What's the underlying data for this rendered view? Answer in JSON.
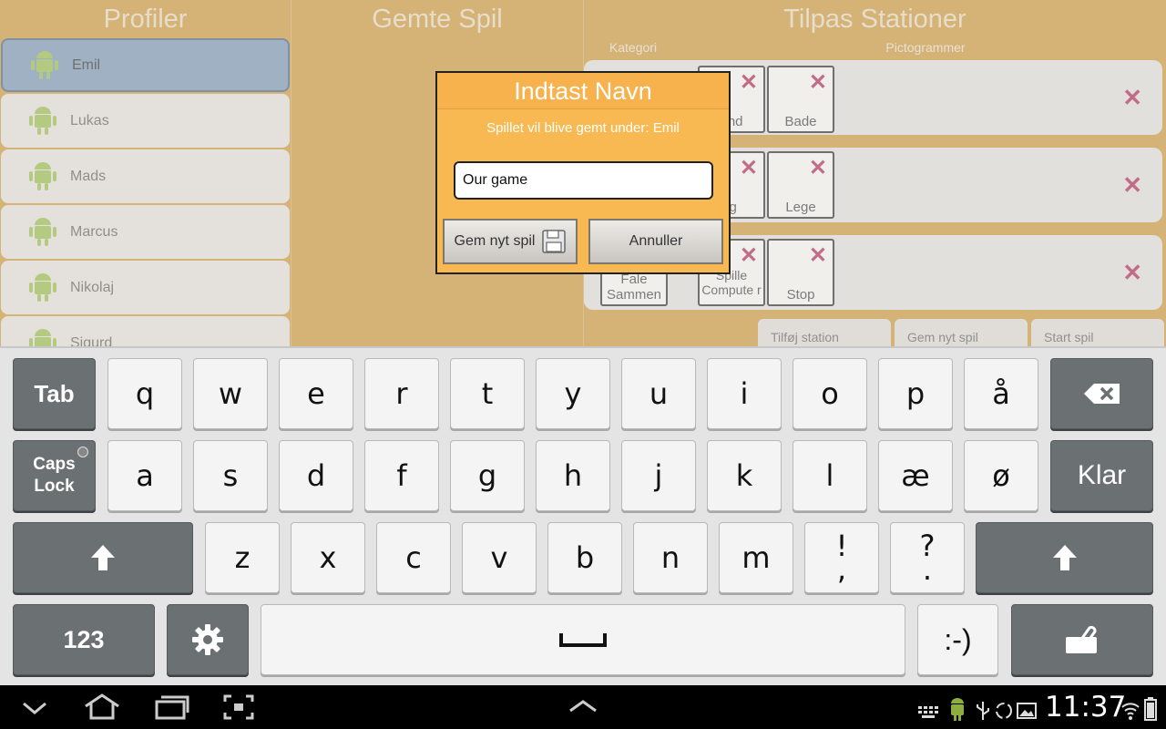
{
  "columns": {
    "profiles": "Profiler",
    "saved_games": "Gemte Spil",
    "stations": "Tilpas Stationer"
  },
  "profiles": [
    {
      "name": "Emil",
      "selected": true
    },
    {
      "name": "Lukas",
      "selected": false
    },
    {
      "name": "Mads",
      "selected": false
    },
    {
      "name": "Marcus",
      "selected": false
    },
    {
      "name": "Nikolaj",
      "selected": false
    },
    {
      "name": "Sigurd",
      "selected": false
    }
  ],
  "stations_panel": {
    "category_header": "Kategori",
    "pictograms_header": "Pictogrammer",
    "stations": [
      {
        "pictos": [
          "und",
          "Bade"
        ]
      },
      {
        "pictos": [
          "ig",
          "Lege"
        ]
      },
      {
        "category": "Fale Sammen",
        "pictos": [
          "Spille Compute r",
          "Stop"
        ]
      }
    ],
    "buttons": [
      "Tilføj station",
      "Gem nyt spil",
      "Start spil"
    ]
  },
  "dialog": {
    "title": "Indtast Navn",
    "message": "Spillet vil blive gemt under: Emil",
    "input_value": "Our game",
    "save_button": "Gem nyt spil",
    "cancel_button": "Annuller"
  },
  "keyboard": {
    "row1": [
      "q",
      "w",
      "e",
      "r",
      "t",
      "y",
      "u",
      "i",
      "o",
      "p",
      "å"
    ],
    "row2": [
      "a",
      "s",
      "d",
      "f",
      "g",
      "h",
      "j",
      "k",
      "l",
      "æ",
      "ø"
    ],
    "row3": [
      "z",
      "x",
      "c",
      "v",
      "b",
      "n",
      "m"
    ],
    "tab": "Tab",
    "caps_lock": "Caps Lock",
    "done": "Klar",
    "numbers": "123",
    "smiley": ":-)",
    "punct1": "!",
    "punct1_sub": ",",
    "punct2": "?",
    "punct2_sub": "."
  },
  "statusbar": {
    "time": "11:37"
  },
  "colors": {
    "app_bg": "#bf8a2e",
    "dialog_bg": "#f9b952",
    "delete": "#a0204a",
    "selected_profile": "#6c88a4"
  }
}
